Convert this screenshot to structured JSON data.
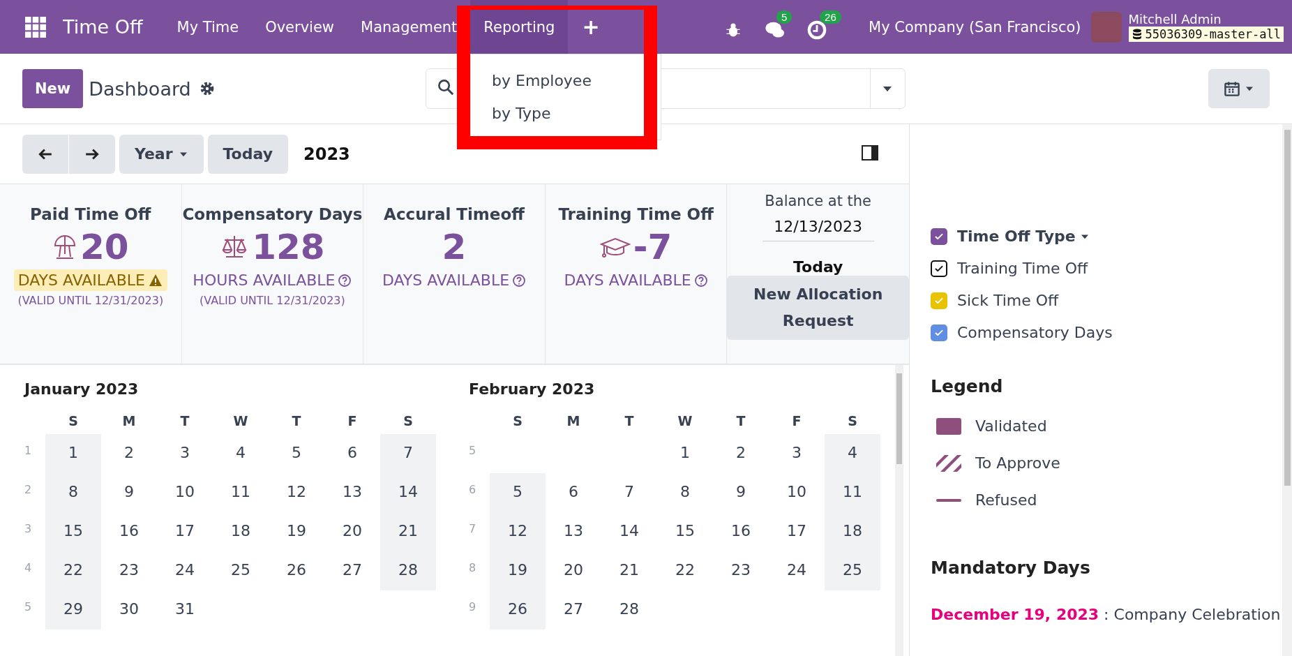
{
  "navbar": {
    "app_title": "Time Off",
    "menu": [
      {
        "label": "My Time",
        "selected": false
      },
      {
        "label": "Overview",
        "selected": false
      },
      {
        "label": "Management",
        "selected": false
      },
      {
        "label": "Reporting",
        "selected": true
      }
    ],
    "add_label": "+",
    "badges": [
      {
        "kind": "bug"
      },
      {
        "kind": "chat",
        "count": "5"
      },
      {
        "kind": "activity",
        "count": "26"
      }
    ],
    "company": "My Company (San Francisco)",
    "user": "Mitchell Admin",
    "database": "55036309-master-all"
  },
  "dropdown": {
    "items": [
      "by Employee",
      "by Type"
    ]
  },
  "control_panel": {
    "new_button": "New",
    "title": "Dashboard"
  },
  "toolbar": {
    "scale": "Year",
    "today": "Today",
    "period": "2023"
  },
  "balance_cards": [
    {
      "kind": "umbrella",
      "title": "Paid Time Off",
      "value": "20",
      "unit": "DAYS AVAILABLE",
      "warning": true,
      "validity": "(VALID UNTIL 12/31/2023)"
    },
    {
      "kind": "scales",
      "title": "Compensatory Days",
      "value": "128",
      "unit": "HOURS AVAILABLE",
      "warning": false,
      "validity": "(VALID UNTIL 12/31/2023)"
    },
    {
      "kind": "plain",
      "title": "Accural Timeoff",
      "value": "2",
      "unit": "DAYS AVAILABLE",
      "warning": false
    },
    {
      "kind": "graduation",
      "title": "Training Time Off",
      "value": "-7",
      "unit": "DAYS AVAILABLE",
      "warning": false
    }
  ],
  "balance_date": {
    "label": "Balance at the",
    "date": "12/13/2023",
    "today": "Today",
    "allocation_button": "New Allocation Request"
  },
  "calendar": {
    "months": [
      {
        "title": "January 2023",
        "weekdays": [
          "S",
          "M",
          "T",
          "W",
          "T",
          "F",
          "S"
        ],
        "weeks": [
          {
            "number": "1",
            "days": [
              "1",
              "2",
              "3",
              "4",
              "5",
              "6",
              "7"
            ]
          },
          {
            "number": "2",
            "days": [
              "8",
              "9",
              "10",
              "11",
              "12",
              "13",
              "14"
            ]
          },
          {
            "number": "3",
            "days": [
              "15",
              "16",
              "17",
              "18",
              "19",
              "20",
              "21"
            ]
          },
          {
            "number": "4",
            "days": [
              "22",
              "23",
              "24",
              "25",
              "26",
              "27",
              "28"
            ]
          },
          {
            "number": "5",
            "starts_midweek": false,
            "days": [
              "29",
              "30",
              "31"
            ]
          }
        ]
      },
      {
        "title": "February 2023",
        "weekdays": [
          "S",
          "M",
          "T",
          "W",
          "T",
          "F",
          "S"
        ],
        "weeks": [
          {
            "number": "5",
            "starts_midweek": true,
            "days": [
              "1",
              "2",
              "3",
              "4"
            ]
          },
          {
            "number": "6",
            "days": [
              "5",
              "6",
              "7",
              "8",
              "9",
              "10",
              "11"
            ]
          },
          {
            "number": "7",
            "days": [
              "12",
              "13",
              "14",
              "15",
              "16",
              "17",
              "18"
            ]
          },
          {
            "number": "8",
            "days": [
              "19",
              "20",
              "21",
              "22",
              "23",
              "24",
              "25"
            ]
          },
          {
            "number": "9",
            "starts_midweek": false,
            "days": [
              "26",
              "27",
              "28"
            ]
          }
        ]
      }
    ]
  },
  "filters": {
    "title": "Time Off Type",
    "checked": true,
    "color": "#7b519d",
    "items": [
      {
        "label": "Training Time Off",
        "checked": true,
        "color": "#ffffff"
      },
      {
        "label": "Sick Time Off",
        "checked": true,
        "color": "#e8c300"
      },
      {
        "label": "Compensatory Days",
        "checked": true,
        "color": "#5f8ee2"
      }
    ]
  },
  "legend": {
    "title": "Legend",
    "items": [
      {
        "kind": "validated",
        "label": "Validated"
      },
      {
        "kind": "to_approve",
        "label": "To Approve"
      },
      {
        "kind": "refused",
        "label": "Refused"
      }
    ]
  },
  "mandatory_days": {
    "title": "Mandatory Days",
    "items": [
      {
        "date": "December 19, 2023",
        "description": ": Company Celebration"
      }
    ]
  }
}
